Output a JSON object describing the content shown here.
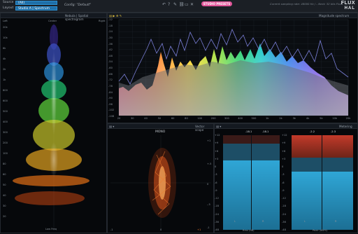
{
  "toolbar": {
    "source_label": "Source",
    "source_value": "(All)",
    "layout_label": "Layout",
    "layout_value": "Studio A | Spectrum",
    "config_text": "Config: \"Default\"",
    "studio_badge": "STUDIO PRESETS",
    "sampling_text": "Current sampling rate: 48000 Hz / – Next: 32 bits Float",
    "logo_top": "FLUX",
    "logo_bottom": "HAL"
  },
  "nebula": {
    "title": "Nebula | Spatial spectrogram",
    "left": "Left",
    "center": "Center",
    "right": "Right",
    "bottom_label": "Low Freq",
    "freq_ticks": [
      "20k",
      "10k",
      "6k",
      "4k",
      "2k",
      "1k",
      "800",
      "600",
      "500",
      "400",
      "300",
      "200",
      "100",
      "80",
      "60",
      "50",
      "40",
      "30",
      "20"
    ]
  },
  "magnitude": {
    "title": "Magnitude spectrum",
    "db_ticks": [
      "-12",
      "-18",
      "-24",
      "-30",
      "-36",
      "-42",
      "-48",
      "-54",
      "-60",
      "-66",
      "-72",
      "-78",
      "-84",
      "-90",
      "-96",
      "-102",
      "-108"
    ],
    "freq_ticks": [
      "20",
      "30",
      "40",
      "50",
      "60",
      "80",
      "100",
      "200",
      "300",
      "400",
      "500",
      "1k",
      "2k",
      "3k",
      "4k",
      "5k",
      "10k",
      "20k"
    ]
  },
  "vector": {
    "title": "Vector scope",
    "mode": "MONO",
    "ticks_right": [
      "+1",
      "+.5",
      "0",
      "-.5",
      "-1"
    ],
    "ticks_bottom": [
      "-1",
      "0",
      "+1"
    ]
  },
  "metering": {
    "title": "Metering",
    "rms_peak_left": "-18.1",
    "rms_peak_right": "-18.1",
    "peak_left": "-2.2",
    "peak_right": "-2.3",
    "scale": [
      "+12",
      "+9",
      "+6",
      "+3",
      "0",
      "-3",
      "-6",
      "-9",
      "-12",
      "-18",
      "-24",
      "-36",
      "-48"
    ],
    "rms_label": "Rms (dB)",
    "peak_label": "Peak (dBFS)",
    "channel_l": "L",
    "channel_r": "R"
  },
  "colors": {
    "accent": "#1f6fa8",
    "badge": "#e1569a",
    "meter_blue": "#2fa6d6",
    "meter_red": "#c23a2a"
  }
}
